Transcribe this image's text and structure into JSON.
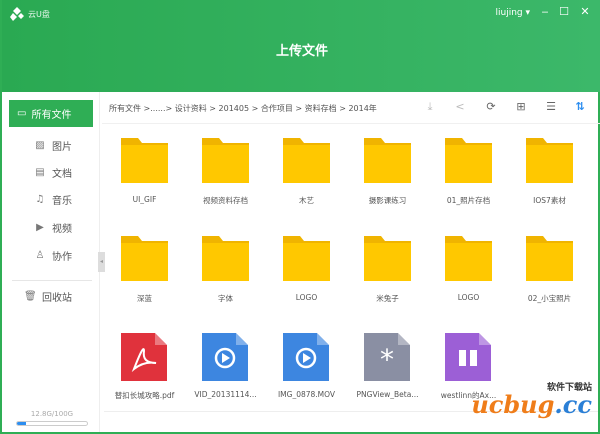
{
  "app": {
    "name": "云U盘",
    "user": "liujing",
    "title": "上传文件"
  },
  "colors": {
    "accent": "#2fae55",
    "folder": "#ffc800",
    "pdf": "#e0323c",
    "video": "#3d86e0",
    "generic": "#8a8fa3",
    "archive": "#9c5fd6"
  },
  "sidebar": {
    "active": "所有文件",
    "items": [
      {
        "label": "图片",
        "icon": "image-icon"
      },
      {
        "label": "文档",
        "icon": "document-icon"
      },
      {
        "label": "音乐",
        "icon": "music-icon"
      },
      {
        "label": "视频",
        "icon": "video-icon"
      },
      {
        "label": "协作",
        "icon": "user-icon"
      }
    ],
    "trash": "回收站",
    "storage": "12.8G/100G",
    "storage_used_pct": 12.8
  },
  "breadcrumb": "所有文件 >......> 设计资料 > 201405 > 合作项目 > 资料存档 > 2014年",
  "toolbar": [
    "download-icon",
    "share-icon",
    "refresh-icon",
    "new-folder-icon",
    "list-view-icon",
    "sort-icon"
  ],
  "folders": [
    "UI_GIF",
    "视频资料存档",
    "木艺",
    "摄影课练习",
    "01_照片存档",
    "IOS7素材",
    "深蓝",
    "字体",
    "LOGO",
    "米兔子",
    "LOGO",
    "02_小宝照片"
  ],
  "files": [
    {
      "name": "替扣长城攻略.pdf",
      "type": "pdf"
    },
    {
      "name": "VID_20131114...",
      "type": "video"
    },
    {
      "name": "IMG_0878.MOV",
      "type": "video"
    },
    {
      "name": "PNGView_Beta...",
      "type": "generic"
    },
    {
      "name": "westlinn的Ax...",
      "type": "archive"
    }
  ],
  "watermark": {
    "top": "软件下载站",
    "brand": "ucbug",
    "suffix": ".cc"
  }
}
